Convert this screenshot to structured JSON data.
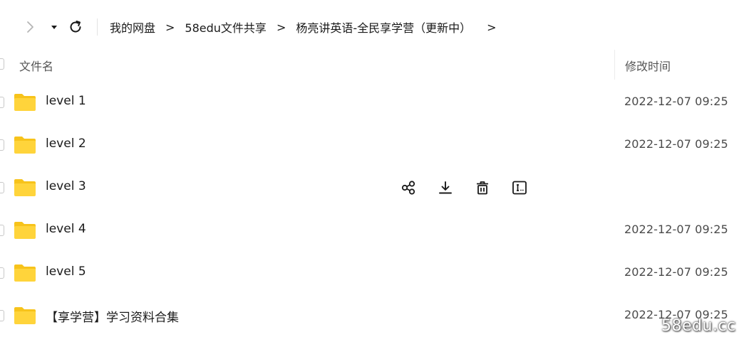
{
  "nav": {
    "forward_icon": "chevron-right-icon",
    "dropdown_icon": "caret-down-icon",
    "refresh_icon": "refresh-icon",
    "breadcrumb": [
      "我的网盘",
      "58edu文件共享",
      "杨亮讲英语-全民享学营（更新中）"
    ],
    "separator": ">"
  },
  "columns": {
    "name": "文件名",
    "modified": "修改时间"
  },
  "rows": [
    {
      "name": "level 1",
      "time": "2022-12-07 09:25",
      "icon": "folder-icon"
    },
    {
      "name": "level 2",
      "time": "2022-12-07 09:25",
      "icon": "folder-icon"
    },
    {
      "name": "level 3",
      "time": "",
      "icon": "folder-icon",
      "hovered": true
    },
    {
      "name": "level 4",
      "time": "2022-12-07 09:25",
      "icon": "folder-icon"
    },
    {
      "name": "level 5",
      "time": "2022-12-07 09:25",
      "icon": "folder-icon"
    },
    {
      "name": "【享学营】学习资料合集",
      "time": "2022-12-07 09:25",
      "icon": "folder-icon"
    }
  ],
  "row_actions": [
    "share-icon",
    "download-icon",
    "delete-icon",
    "rename-icon"
  ],
  "watermark": "58edu.cc",
  "colors": {
    "folder": "#FFD43B",
    "folder_tab": "#F7C31B",
    "text": "#1a1a1a",
    "muted": "#555555"
  }
}
